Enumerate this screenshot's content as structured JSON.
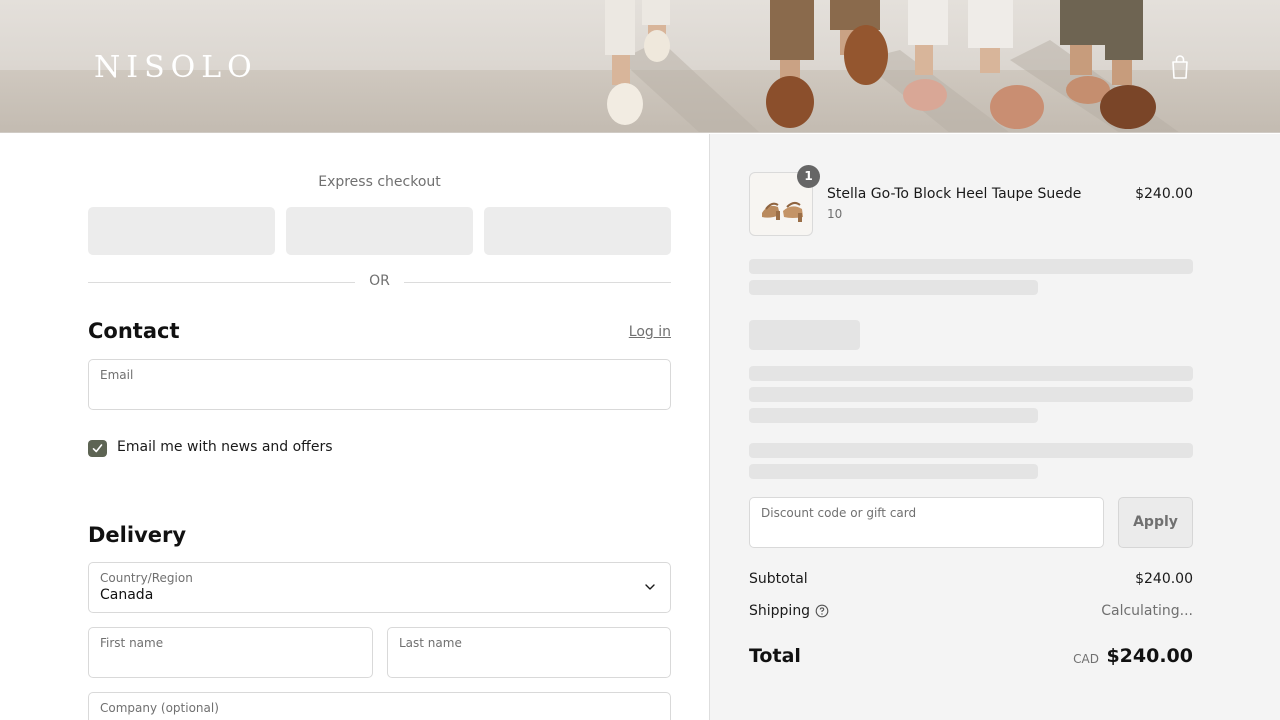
{
  "header": {
    "logo": "NISOLO",
    "cart_icon": "shopping-bag-icon"
  },
  "express": {
    "title": "Express checkout",
    "divider_text": "OR"
  },
  "contact": {
    "title": "Contact",
    "login_label": "Log in",
    "email": {
      "label": "Email",
      "value": ""
    },
    "newsletter": {
      "label": "Email me with news and offers",
      "checked": true
    }
  },
  "delivery": {
    "title": "Delivery",
    "country": {
      "label": "Country/Region",
      "value": "Canada"
    },
    "first_name": {
      "label": "First name",
      "value": ""
    },
    "last_name": {
      "label": "Last name",
      "value": ""
    },
    "company": {
      "label": "Company (optional)",
      "value": ""
    }
  },
  "order": {
    "item": {
      "name": "Stella Go-To Block Heel Taupe Suede",
      "variant": "10",
      "quantity": "1",
      "price": "$240.00"
    },
    "discount": {
      "placeholder": "Discount code or gift card",
      "apply_label": "Apply"
    },
    "subtotal": {
      "label": "Subtotal",
      "value": "$240.00"
    },
    "shipping": {
      "label": "Shipping",
      "value": "Calculating..."
    },
    "total": {
      "label": "Total",
      "currency": "CAD",
      "value": "$240.00"
    }
  },
  "colors": {
    "accent": "#5d6453",
    "panel": "#f4f4f4",
    "skeleton": "#e4e4e4"
  }
}
